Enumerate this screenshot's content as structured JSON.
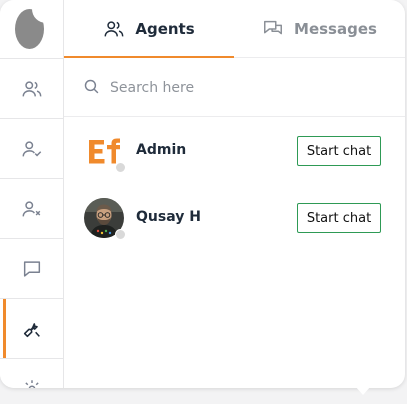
{
  "tabs": {
    "agents": {
      "label": "Agents",
      "icon": "users-icon"
    },
    "messages": {
      "label": "Messages",
      "icon": "chat-bubbles-icon"
    }
  },
  "search": {
    "placeholder": "Search here",
    "value": ""
  },
  "rail": {
    "items": [
      {
        "icon": "users-icon"
      },
      {
        "icon": "user-check-icon"
      },
      {
        "icon": "user-x-icon"
      },
      {
        "icon": "chat-bubble-icon"
      },
      {
        "icon": "wrench-icon"
      },
      {
        "icon": "gear-icon"
      }
    ],
    "active_index": 4
  },
  "agents": [
    {
      "name": "Admin",
      "avatar": "ef-logo",
      "status": "offline",
      "action_label": "Start chat"
    },
    {
      "name": "Qusay H",
      "avatar": "photo",
      "status": "offline",
      "action_label": "Start chat"
    }
  ],
  "colors": {
    "accent": "#f08a2c",
    "button_border": "#2e9a55",
    "text_dark": "#1f2b3a",
    "text_muted": "#8a8f96",
    "status_offline": "#d9d9d9"
  }
}
